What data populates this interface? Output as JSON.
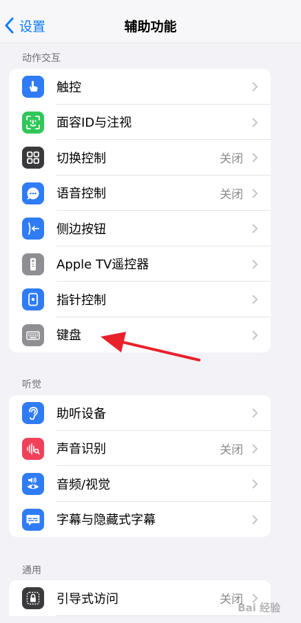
{
  "nav": {
    "back_label": "设置",
    "title": "辅助功能"
  },
  "sections": [
    {
      "header": "动作交互"
    },
    {
      "header": "听觉"
    },
    {
      "header": "通用"
    }
  ],
  "interaction": [
    {
      "label": "触控",
      "value": "",
      "icon": "hand-touch-icon"
    },
    {
      "label": "面容ID与注视",
      "value": "",
      "icon": "face-id-icon"
    },
    {
      "label": "切换控制",
      "value": "关闭",
      "icon": "switch-grid-icon"
    },
    {
      "label": "语音控制",
      "value": "关闭",
      "icon": "voice-control-icon"
    },
    {
      "label": "侧边按钮",
      "value": "",
      "icon": "side-button-icon"
    },
    {
      "label": "Apple TV遥控器",
      "value": "",
      "icon": "tv-remote-icon"
    },
    {
      "label": "指针控制",
      "value": "",
      "icon": "pointer-control-icon"
    },
    {
      "label": "键盘",
      "value": "",
      "icon": "keyboard-icon"
    }
  ],
  "hearing": [
    {
      "label": "助听设备",
      "value": "",
      "icon": "ear-icon"
    },
    {
      "label": "声音识别",
      "value": "关闭",
      "icon": "sound-recognition-icon"
    },
    {
      "label": "音频/视觉",
      "value": "",
      "icon": "audio-visual-icon"
    },
    {
      "label": "字幕与隐藏式字幕",
      "value": "",
      "icon": "subtitles-icon"
    }
  ],
  "general": [
    {
      "label": "引导式访问",
      "value": "关闭",
      "icon": "lock-icon"
    }
  ],
  "colors": {
    "blue": "#0a7aff",
    "icon_blue": "#2f7cf6",
    "green": "#30c759",
    "dark": "#3a3a3c",
    "gray": "#8e8e93",
    "pink": "#f0405a",
    "arrow": "#e8212b"
  },
  "watermark": "Bai 经验"
}
